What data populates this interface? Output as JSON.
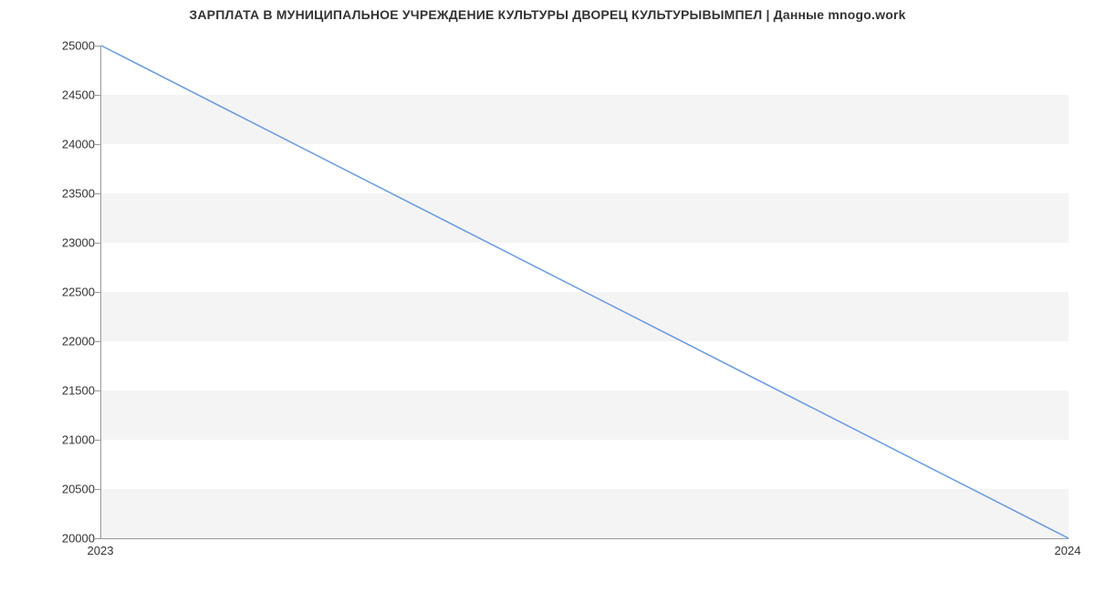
{
  "chart_data": {
    "type": "line",
    "title": "ЗАРПЛАТА В МУНИЦИПАЛЬНОЕ УЧРЕЖДЕНИЕ КУЛЬТУРЫ ДВОРЕЦ КУЛЬТУРЫВЫМПЕЛ | Данные mnogo.work",
    "x": [
      2023,
      2024
    ],
    "series": [
      {
        "name": "salary",
        "values": [
          25000,
          20000
        ],
        "color": "#6699e0"
      }
    ],
    "xlabel": "",
    "ylabel": "",
    "xlim": [
      2023,
      2024
    ],
    "ylim": [
      20000,
      25000
    ],
    "y_ticks": [
      20000,
      20500,
      21000,
      21500,
      22000,
      22500,
      23000,
      23500,
      24000,
      24500,
      25000
    ],
    "x_ticks": [
      2023,
      2024
    ],
    "grid_bands": true
  }
}
